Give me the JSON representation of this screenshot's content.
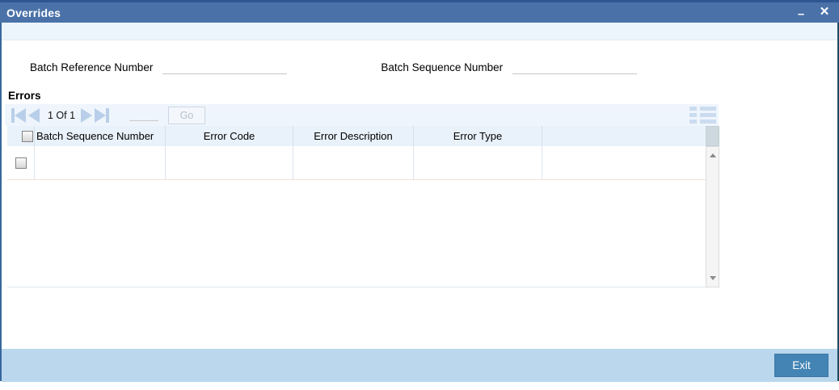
{
  "window": {
    "title": "Overrides",
    "minimize_icon": "–",
    "close_icon": "✕"
  },
  "fields": {
    "batch_reference_number": {
      "label": "Batch Reference Number",
      "value": ""
    },
    "batch_sequence_number": {
      "label": "Batch Sequence Number",
      "value": ""
    }
  },
  "errors_section": {
    "title": "Errors",
    "pagination": {
      "page_indicator": "1 Of 1",
      "page_input_value": "",
      "go_button": "Go"
    },
    "table": {
      "columns": [
        "Batch Sequence Number",
        "Error Code",
        "Error Description",
        "Error Type",
        ""
      ],
      "rows": [
        {
          "checked": false,
          "cells": [
            "",
            "",
            "",
            "",
            ""
          ]
        }
      ]
    }
  },
  "footer": {
    "exit_button": "Exit"
  },
  "colors": {
    "titlebar": "#4a72a8",
    "titlebar_top_edge": "#2d5691",
    "top_strip": "#ecf4fc",
    "pagination_bg": "#eff5fc",
    "nav_arrow": "#b9cfe9",
    "header_bg": "#e9f1fa",
    "footer_bar": "#bad7ed",
    "exit_button": "#4384b4"
  }
}
